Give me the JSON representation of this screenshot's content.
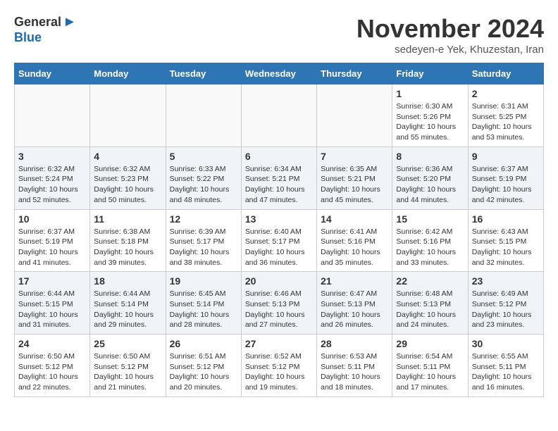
{
  "header": {
    "logo_general": "General",
    "logo_blue": "Blue",
    "title": "November 2024",
    "subtitle": "sedeyen-e Yek, Khuzestan, Iran"
  },
  "weekdays": [
    "Sunday",
    "Monday",
    "Tuesday",
    "Wednesday",
    "Thursday",
    "Friday",
    "Saturday"
  ],
  "weeks": [
    [
      {
        "day": "",
        "empty": true
      },
      {
        "day": "",
        "empty": true
      },
      {
        "day": "",
        "empty": true
      },
      {
        "day": "",
        "empty": true
      },
      {
        "day": "",
        "empty": true
      },
      {
        "day": "1",
        "sunrise": "Sunrise: 6:30 AM",
        "sunset": "Sunset: 5:26 PM",
        "daylight": "Daylight: 10 hours and 55 minutes."
      },
      {
        "day": "2",
        "sunrise": "Sunrise: 6:31 AM",
        "sunset": "Sunset: 5:25 PM",
        "daylight": "Daylight: 10 hours and 53 minutes."
      }
    ],
    [
      {
        "day": "3",
        "sunrise": "Sunrise: 6:32 AM",
        "sunset": "Sunset: 5:24 PM",
        "daylight": "Daylight: 10 hours and 52 minutes."
      },
      {
        "day": "4",
        "sunrise": "Sunrise: 6:32 AM",
        "sunset": "Sunset: 5:23 PM",
        "daylight": "Daylight: 10 hours and 50 minutes."
      },
      {
        "day": "5",
        "sunrise": "Sunrise: 6:33 AM",
        "sunset": "Sunset: 5:22 PM",
        "daylight": "Daylight: 10 hours and 48 minutes."
      },
      {
        "day": "6",
        "sunrise": "Sunrise: 6:34 AM",
        "sunset": "Sunset: 5:21 PM",
        "daylight": "Daylight: 10 hours and 47 minutes."
      },
      {
        "day": "7",
        "sunrise": "Sunrise: 6:35 AM",
        "sunset": "Sunset: 5:21 PM",
        "daylight": "Daylight: 10 hours and 45 minutes."
      },
      {
        "day": "8",
        "sunrise": "Sunrise: 6:36 AM",
        "sunset": "Sunset: 5:20 PM",
        "daylight": "Daylight: 10 hours and 44 minutes."
      },
      {
        "day": "9",
        "sunrise": "Sunrise: 6:37 AM",
        "sunset": "Sunset: 5:19 PM",
        "daylight": "Daylight: 10 hours and 42 minutes."
      }
    ],
    [
      {
        "day": "10",
        "sunrise": "Sunrise: 6:37 AM",
        "sunset": "Sunset: 5:19 PM",
        "daylight": "Daylight: 10 hours and 41 minutes."
      },
      {
        "day": "11",
        "sunrise": "Sunrise: 6:38 AM",
        "sunset": "Sunset: 5:18 PM",
        "daylight": "Daylight: 10 hours and 39 minutes."
      },
      {
        "day": "12",
        "sunrise": "Sunrise: 6:39 AM",
        "sunset": "Sunset: 5:17 PM",
        "daylight": "Daylight: 10 hours and 38 minutes."
      },
      {
        "day": "13",
        "sunrise": "Sunrise: 6:40 AM",
        "sunset": "Sunset: 5:17 PM",
        "daylight": "Daylight: 10 hours and 36 minutes."
      },
      {
        "day": "14",
        "sunrise": "Sunrise: 6:41 AM",
        "sunset": "Sunset: 5:16 PM",
        "daylight": "Daylight: 10 hours and 35 minutes."
      },
      {
        "day": "15",
        "sunrise": "Sunrise: 6:42 AM",
        "sunset": "Sunset: 5:16 PM",
        "daylight": "Daylight: 10 hours and 33 minutes."
      },
      {
        "day": "16",
        "sunrise": "Sunrise: 6:43 AM",
        "sunset": "Sunset: 5:15 PM",
        "daylight": "Daylight: 10 hours and 32 minutes."
      }
    ],
    [
      {
        "day": "17",
        "sunrise": "Sunrise: 6:44 AM",
        "sunset": "Sunset: 5:15 PM",
        "daylight": "Daylight: 10 hours and 31 minutes."
      },
      {
        "day": "18",
        "sunrise": "Sunrise: 6:44 AM",
        "sunset": "Sunset: 5:14 PM",
        "daylight": "Daylight: 10 hours and 29 minutes."
      },
      {
        "day": "19",
        "sunrise": "Sunrise: 6:45 AM",
        "sunset": "Sunset: 5:14 PM",
        "daylight": "Daylight: 10 hours and 28 minutes."
      },
      {
        "day": "20",
        "sunrise": "Sunrise: 6:46 AM",
        "sunset": "Sunset: 5:13 PM",
        "daylight": "Daylight: 10 hours and 27 minutes."
      },
      {
        "day": "21",
        "sunrise": "Sunrise: 6:47 AM",
        "sunset": "Sunset: 5:13 PM",
        "daylight": "Daylight: 10 hours and 26 minutes."
      },
      {
        "day": "22",
        "sunrise": "Sunrise: 6:48 AM",
        "sunset": "Sunset: 5:13 PM",
        "daylight": "Daylight: 10 hours and 24 minutes."
      },
      {
        "day": "23",
        "sunrise": "Sunrise: 6:49 AM",
        "sunset": "Sunset: 5:12 PM",
        "daylight": "Daylight: 10 hours and 23 minutes."
      }
    ],
    [
      {
        "day": "24",
        "sunrise": "Sunrise: 6:50 AM",
        "sunset": "Sunset: 5:12 PM",
        "daylight": "Daylight: 10 hours and 22 minutes."
      },
      {
        "day": "25",
        "sunrise": "Sunrise: 6:50 AM",
        "sunset": "Sunset: 5:12 PM",
        "daylight": "Daylight: 10 hours and 21 minutes."
      },
      {
        "day": "26",
        "sunrise": "Sunrise: 6:51 AM",
        "sunset": "Sunset: 5:12 PM",
        "daylight": "Daylight: 10 hours and 20 minutes."
      },
      {
        "day": "27",
        "sunrise": "Sunrise: 6:52 AM",
        "sunset": "Sunset: 5:12 PM",
        "daylight": "Daylight: 10 hours and 19 minutes."
      },
      {
        "day": "28",
        "sunrise": "Sunrise: 6:53 AM",
        "sunset": "Sunset: 5:11 PM",
        "daylight": "Daylight: 10 hours and 18 minutes."
      },
      {
        "day": "29",
        "sunrise": "Sunrise: 6:54 AM",
        "sunset": "Sunset: 5:11 PM",
        "daylight": "Daylight: 10 hours and 17 minutes."
      },
      {
        "day": "30",
        "sunrise": "Sunrise: 6:55 AM",
        "sunset": "Sunset: 5:11 PM",
        "daylight": "Daylight: 10 hours and 16 minutes."
      }
    ]
  ]
}
